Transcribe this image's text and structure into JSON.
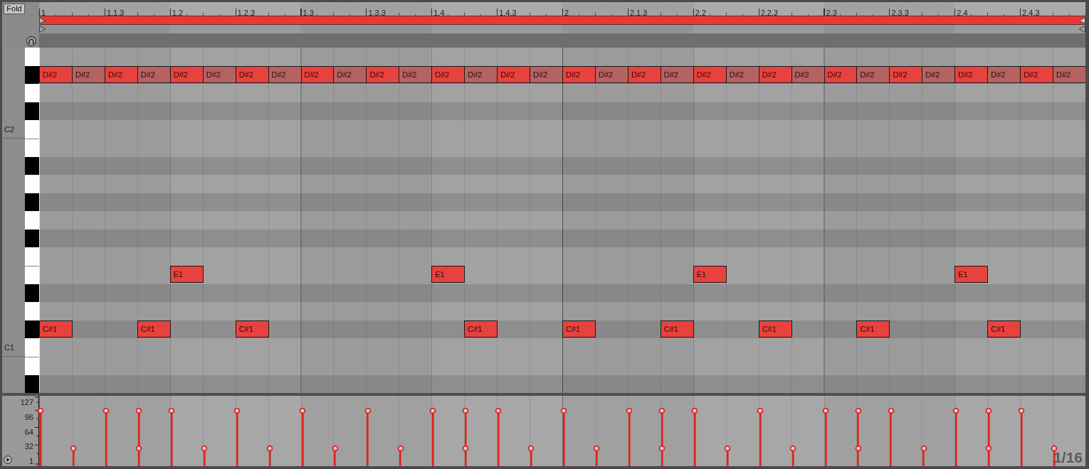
{
  "editor": {
    "fold_button": {
      "label": "Fold",
      "on": false
    },
    "loop": {
      "on": true
    }
  },
  "ruler": {
    "labels": [
      "1",
      "1.1.3",
      "1.2",
      "1.2.3",
      "1.3",
      "1.3.3",
      "1.4",
      "1.4.3",
      "2",
      "2.1.3",
      "2.2",
      "2.2.3",
      "2.3",
      "2.3.3",
      "2.4",
      "2.4.3"
    ]
  },
  "piano_roll": {
    "rows": [
      {
        "kind": "white"
      },
      {
        "kind": "black",
        "steps": [
          {
            "kind": "note",
            "label": "D#2",
            "color": "#e8423e"
          },
          {
            "kind": "note",
            "label": "D#2",
            "color": "#b56262"
          },
          {
            "kind": "note",
            "label": "D#2",
            "color": "#e8423e"
          },
          {
            "kind": "note",
            "label": "D#2",
            "color": "#b56262"
          },
          {
            "kind": "note",
            "label": "D#2",
            "color": "#e8423e"
          },
          {
            "kind": "note",
            "label": "D#2",
            "color": "#b56262"
          },
          {
            "kind": "note",
            "label": "D#2",
            "color": "#e8423e"
          },
          {
            "kind": "note",
            "label": "D#2",
            "color": "#b56262"
          },
          {
            "kind": "note",
            "label": "D#2",
            "color": "#e8423e"
          },
          {
            "kind": "note",
            "label": "D#2",
            "color": "#b56262"
          },
          {
            "kind": "note",
            "label": "D#2",
            "color": "#e8423e"
          },
          {
            "kind": "note",
            "label": "D#2",
            "color": "#b56262"
          },
          {
            "kind": "note",
            "label": "D#2",
            "color": "#e8423e"
          },
          {
            "kind": "note",
            "label": "D#2",
            "color": "#b56262"
          },
          {
            "kind": "note",
            "label": "D#2",
            "color": "#e8423e"
          },
          {
            "kind": "note",
            "label": "D#2",
            "color": "#b56262"
          },
          {
            "kind": "note",
            "label": "D#2",
            "color": "#e8423e"
          },
          {
            "kind": "note",
            "label": "D#2",
            "color": "#b56262"
          },
          {
            "kind": "note",
            "label": "D#2",
            "color": "#e8423e"
          },
          {
            "kind": "note",
            "label": "D#2",
            "color": "#b56262"
          },
          {
            "kind": "note",
            "label": "D#2",
            "color": "#e8423e"
          },
          {
            "kind": "note",
            "label": "D#2",
            "color": "#b56262"
          },
          {
            "kind": "note",
            "label": "D#2",
            "color": "#e8423e"
          },
          {
            "kind": "note",
            "label": "D#2",
            "color": "#b56262"
          },
          {
            "kind": "note",
            "label": "D#2",
            "color": "#e8423e"
          },
          {
            "kind": "note",
            "label": "D#2",
            "color": "#b56262"
          },
          {
            "kind": "note",
            "label": "D#2",
            "color": "#e8423e"
          },
          {
            "kind": "note",
            "label": "D#2",
            "color": "#b56262"
          },
          {
            "kind": "note",
            "label": "D#2",
            "color": "#e8423e"
          },
          {
            "kind": "note",
            "label": "D#2",
            "color": "#b56262"
          },
          {
            "kind": "note",
            "label": "D#2",
            "color": "#e8423e"
          },
          {
            "kind": "note",
            "label": "D#2",
            "color": "#b56262"
          }
        ]
      },
      {
        "kind": "white"
      },
      {
        "kind": "black"
      },
      {
        "kind": "white",
        "label": "C2"
      },
      {
        "kind": "white"
      },
      {
        "kind": "black"
      },
      {
        "kind": "white"
      },
      {
        "kind": "black"
      },
      {
        "kind": "white"
      },
      {
        "kind": "black"
      },
      {
        "kind": "white"
      },
      {
        "kind": "white",
        "steps": [
          {
            "kind": "rest"
          },
          {
            "kind": "rest"
          },
          {
            "kind": "rest"
          },
          {
            "kind": "rest"
          },
          {
            "kind": "note",
            "label": "E1",
            "color": "#e8423e"
          },
          {
            "kind": "rest"
          },
          {
            "kind": "rest"
          },
          {
            "kind": "rest"
          },
          {
            "kind": "rest"
          },
          {
            "kind": "rest"
          },
          {
            "kind": "rest"
          },
          {
            "kind": "rest"
          },
          {
            "kind": "note",
            "label": "E1",
            "color": "#e8423e"
          },
          {
            "kind": "rest"
          },
          {
            "kind": "rest"
          },
          {
            "kind": "rest"
          },
          {
            "kind": "rest"
          },
          {
            "kind": "rest"
          },
          {
            "kind": "rest"
          },
          {
            "kind": "rest"
          },
          {
            "kind": "note",
            "label": "E1",
            "color": "#e8423e"
          },
          {
            "kind": "rest"
          },
          {
            "kind": "rest"
          },
          {
            "kind": "rest"
          },
          {
            "kind": "rest"
          },
          {
            "kind": "rest"
          },
          {
            "kind": "rest"
          },
          {
            "kind": "rest"
          },
          {
            "kind": "note",
            "label": "E1",
            "color": "#e8423e"
          },
          {
            "kind": "rest"
          },
          {
            "kind": "rest"
          },
          {
            "kind": "rest"
          }
        ]
      },
      {
        "kind": "black"
      },
      {
        "kind": "white"
      },
      {
        "kind": "black",
        "steps": [
          {
            "kind": "note",
            "label": "C#1",
            "color": "#e8423e"
          },
          {
            "kind": "rest"
          },
          {
            "kind": "rest"
          },
          {
            "kind": "note",
            "label": "C#1",
            "color": "#e8423e"
          },
          {
            "kind": "rest"
          },
          {
            "kind": "rest"
          },
          {
            "kind": "note",
            "label": "C#1",
            "color": "#e8423e"
          },
          {
            "kind": "rest"
          },
          {
            "kind": "rest"
          },
          {
            "kind": "rest"
          },
          {
            "kind": "rest"
          },
          {
            "kind": "rest"
          },
          {
            "kind": "rest"
          },
          {
            "kind": "note",
            "label": "C#1",
            "color": "#e8423e"
          },
          {
            "kind": "rest"
          },
          {
            "kind": "rest"
          },
          {
            "kind": "note",
            "label": "C#1",
            "color": "#e8423e"
          },
          {
            "kind": "rest"
          },
          {
            "kind": "rest"
          },
          {
            "kind": "note",
            "label": "C#1",
            "color": "#e8423e"
          },
          {
            "kind": "rest"
          },
          {
            "kind": "rest"
          },
          {
            "kind": "note",
            "label": "C#1",
            "color": "#e8423e"
          },
          {
            "kind": "rest"
          },
          {
            "kind": "rest"
          },
          {
            "kind": "note",
            "label": "C#1",
            "color": "#e8423e"
          },
          {
            "kind": "rest"
          },
          {
            "kind": "rest"
          },
          {
            "kind": "rest"
          },
          {
            "kind": "note",
            "label": "C#1",
            "color": "#e8423e"
          },
          {
            "kind": "rest"
          },
          {
            "kind": "rest"
          }
        ]
      },
      {
        "kind": "white",
        "label": "C1"
      },
      {
        "kind": "white"
      },
      {
        "kind": "black"
      }
    ]
  },
  "velocity_lane": {
    "axis_labels": [
      "127",
      "96",
      "64",
      "32",
      "1"
    ],
    "steps": [
      {
        "handles": [
          {
            "level": 0.79
          }
        ]
      },
      {
        "handles": [
          {
            "level": 0.25
          }
        ]
      },
      {
        "handles": [
          {
            "level": 0.79
          }
        ]
      },
      {
        "handles": [
          {
            "level": 0.79
          },
          {
            "level": 0.25
          }
        ]
      },
      {
        "handles": [
          {
            "level": 0.79
          }
        ]
      },
      {
        "handles": [
          {
            "level": 0.25
          }
        ]
      },
      {
        "handles": [
          {
            "level": 0.79
          }
        ]
      },
      {
        "handles": [
          {
            "level": 0.25
          }
        ]
      },
      {
        "handles": [
          {
            "level": 0.79
          }
        ]
      },
      {
        "handles": [
          {
            "level": 0.25
          }
        ]
      },
      {
        "handles": [
          {
            "level": 0.79
          }
        ]
      },
      {
        "handles": [
          {
            "level": 0.25
          }
        ]
      },
      {
        "handles": [
          {
            "level": 0.79
          }
        ]
      },
      {
        "handles": [
          {
            "level": 0.79
          },
          {
            "level": 0.25
          }
        ]
      },
      {
        "handles": [
          {
            "level": 0.79
          }
        ]
      },
      {
        "handles": [
          {
            "level": 0.25
          }
        ]
      },
      {
        "handles": [
          {
            "level": 0.79
          }
        ]
      },
      {
        "handles": [
          {
            "level": 0.25
          }
        ]
      },
      {
        "handles": [
          {
            "level": 0.79
          }
        ]
      },
      {
        "handles": [
          {
            "level": 0.79
          },
          {
            "level": 0.25
          }
        ]
      },
      {
        "handles": [
          {
            "level": 0.79
          }
        ]
      },
      {
        "handles": [
          {
            "level": 0.25
          }
        ]
      },
      {
        "handles": [
          {
            "level": 0.79
          }
        ]
      },
      {
        "handles": [
          {
            "level": 0.25
          }
        ]
      },
      {
        "handles": [
          {
            "level": 0.79
          }
        ]
      },
      {
        "handles": [
          {
            "level": 0.79
          },
          {
            "level": 0.25
          }
        ]
      },
      {
        "handles": [
          {
            "level": 0.79
          }
        ]
      },
      {
        "handles": [
          {
            "level": 0.25
          }
        ]
      },
      {
        "handles": [
          {
            "level": 0.79
          }
        ]
      },
      {
        "handles": [
          {
            "level": 0.79
          },
          {
            "level": 0.25
          }
        ]
      },
      {
        "handles": [
          {
            "level": 0.79
          }
        ]
      },
      {
        "handles": [
          {
            "level": 0.25
          }
        ]
      }
    ],
    "grid_resolution": "1/16"
  }
}
